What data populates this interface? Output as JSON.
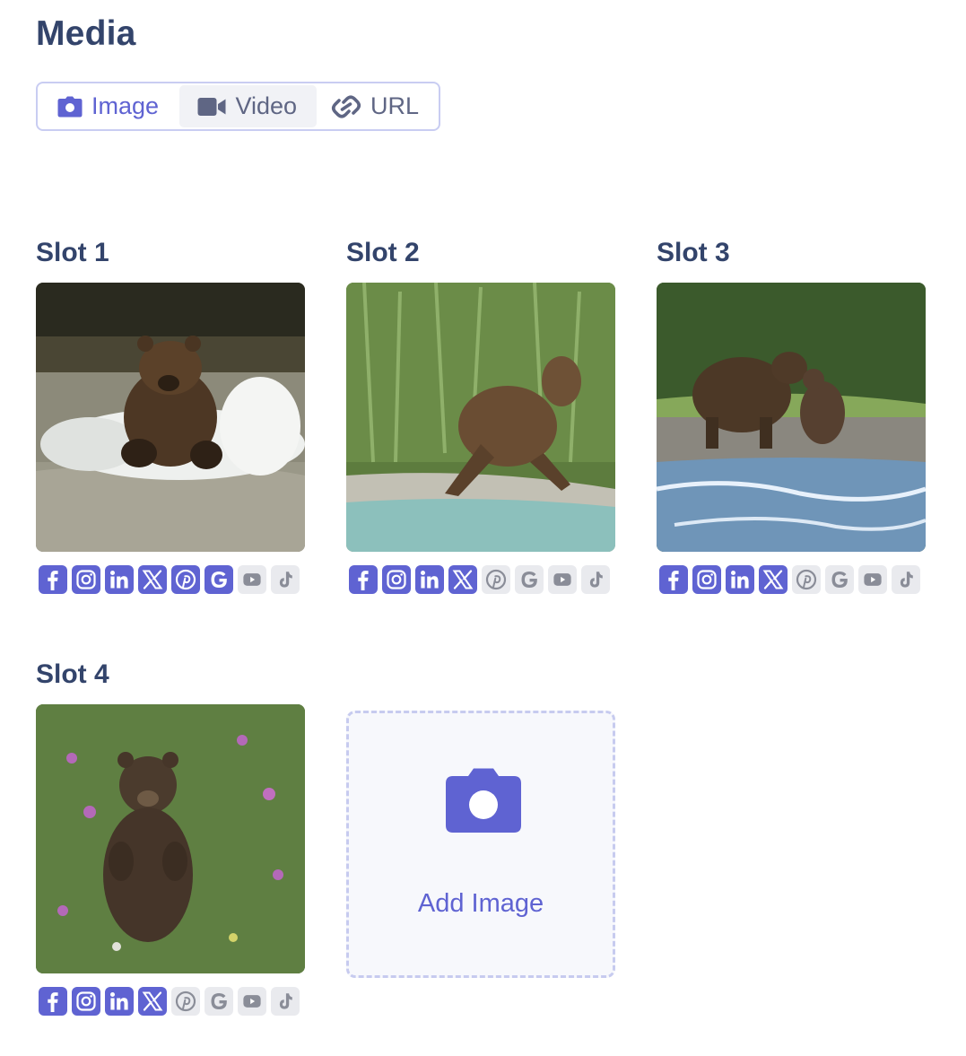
{
  "header": {
    "title": "Media"
  },
  "tabs": [
    {
      "label": "Image",
      "icon": "camera-icon",
      "active": true
    },
    {
      "label": "Video",
      "icon": "video-camera-icon",
      "active": false
    },
    {
      "label": "URL",
      "icon": "link-icon",
      "active": false
    }
  ],
  "slots": [
    {
      "title": "Slot 1",
      "image": "bear-running-through-river",
      "networks": [
        {
          "name": "facebook-icon",
          "enabled": true
        },
        {
          "name": "instagram-icon",
          "enabled": true
        },
        {
          "name": "linkedin-icon",
          "enabled": true
        },
        {
          "name": "x-icon",
          "enabled": true
        },
        {
          "name": "pinterest-icon",
          "enabled": true
        },
        {
          "name": "google-icon",
          "enabled": true
        },
        {
          "name": "youtube-icon",
          "enabled": false
        },
        {
          "name": "tiktok-icon",
          "enabled": false
        }
      ]
    },
    {
      "title": "Slot 2",
      "image": "bear-on-riverbank-grass",
      "networks": [
        {
          "name": "facebook-icon",
          "enabled": true
        },
        {
          "name": "instagram-icon",
          "enabled": true
        },
        {
          "name": "linkedin-icon",
          "enabled": true
        },
        {
          "name": "x-icon",
          "enabled": true
        },
        {
          "name": "pinterest-icon",
          "enabled": false
        },
        {
          "name": "google-icon",
          "enabled": false
        },
        {
          "name": "youtube-icon",
          "enabled": false
        },
        {
          "name": "tiktok-icon",
          "enabled": false
        }
      ]
    },
    {
      "title": "Slot 3",
      "image": "bear-with-cub-by-river",
      "networks": [
        {
          "name": "facebook-icon",
          "enabled": true
        },
        {
          "name": "instagram-icon",
          "enabled": true
        },
        {
          "name": "linkedin-icon",
          "enabled": true
        },
        {
          "name": "x-icon",
          "enabled": true
        },
        {
          "name": "pinterest-icon",
          "enabled": false
        },
        {
          "name": "google-icon",
          "enabled": false
        },
        {
          "name": "youtube-icon",
          "enabled": false
        },
        {
          "name": "tiktok-icon",
          "enabled": false
        }
      ]
    },
    {
      "title": "Slot 4",
      "image": "bear-standing-in-wildflowers",
      "networks": [
        {
          "name": "facebook-icon",
          "enabled": true
        },
        {
          "name": "instagram-icon",
          "enabled": true
        },
        {
          "name": "linkedin-icon",
          "enabled": true
        },
        {
          "name": "x-icon",
          "enabled": true
        },
        {
          "name": "pinterest-icon",
          "enabled": false
        },
        {
          "name": "google-icon",
          "enabled": false
        },
        {
          "name": "youtube-icon",
          "enabled": false
        },
        {
          "name": "tiktok-icon",
          "enabled": false
        }
      ]
    }
  ],
  "add_tile": {
    "label": "Add Image",
    "icon": "camera-icon"
  },
  "colors": {
    "accent": "#5f63d2",
    "heading": "#33446b",
    "disabled_icon_bg": "#e9eaee",
    "tab_border": "#c9cdf2"
  }
}
